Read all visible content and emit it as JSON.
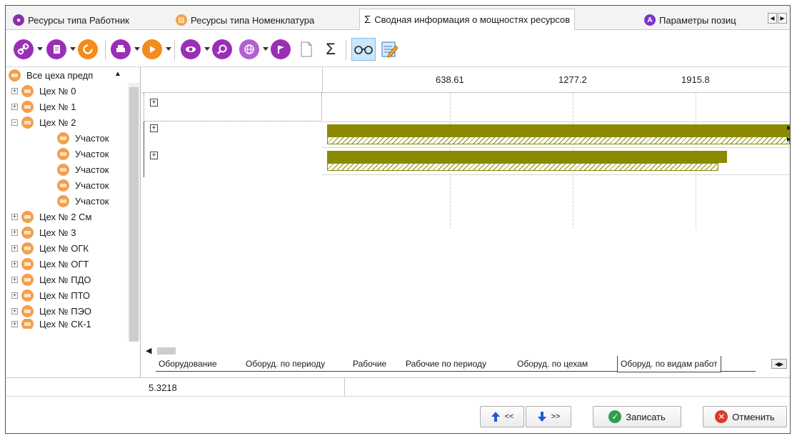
{
  "tabs": [
    {
      "label": "Ресурсы типа Работник"
    },
    {
      "label": "Ресурсы типа Номенклатура"
    },
    {
      "label": "Сводная информация о мощностях ресурсов",
      "icon": "Σ"
    },
    {
      "label": "Параметры позиц"
    }
  ],
  "toolbar": {
    "sigma": "Σ"
  },
  "tree": {
    "root": "Все цеха предп",
    "items": [
      {
        "label": "Цех № 0",
        "expander": "+"
      },
      {
        "label": "Цех № 1",
        "expander": "+"
      },
      {
        "label": "Цех № 2",
        "expander": "−"
      },
      {
        "label": "Участок"
      },
      {
        "label": "Участок"
      },
      {
        "label": "Участок"
      },
      {
        "label": "Участок"
      },
      {
        "label": "Участок"
      },
      {
        "label": "Цех № 2 См",
        "expander": "+"
      },
      {
        "label": "Цех № 3",
        "expander": "+"
      },
      {
        "label": "Цех № ОГК",
        "expander": "+"
      },
      {
        "label": "Цех № ОГТ",
        "expander": "+"
      },
      {
        "label": "Цех № ПДО",
        "expander": "+"
      },
      {
        "label": "Цех № ПТО",
        "expander": "+"
      },
      {
        "label": "Цех № ПЭО",
        "expander": "+"
      },
      {
        "label": "Цех № СК-1",
        "expander": "+"
      }
    ]
  },
  "chart_data": {
    "type": "gantt",
    "scale_ticks": [
      "638.61",
      "1277.2",
      "1915.8"
    ],
    "scale_values": [
      638.61,
      1277.2,
      1915.8
    ],
    "rows": [
      {
        "expander": "+",
        "solid": null,
        "hatched": null
      },
      {
        "expander": "+",
        "solid": [
          0,
          2450
        ],
        "hatched": [
          0,
          2450
        ]
      },
      {
        "expander": "+",
        "solid": [
          0,
          2080
        ],
        "hatched": [
          0,
          2035
        ]
      }
    ]
  },
  "sheet_tabs": [
    "Оборудование",
    "Оборуд. по периоду",
    "Рабочие",
    "Рабочие по периоду",
    "Оборуд. по цехам",
    "Оборуд. по видам работ"
  ],
  "status": {
    "value": "5.3218"
  },
  "footer": {
    "prev_label": "<<",
    "next_label": ">>",
    "save_label": "Записать",
    "cancel_label": "Отменить"
  }
}
